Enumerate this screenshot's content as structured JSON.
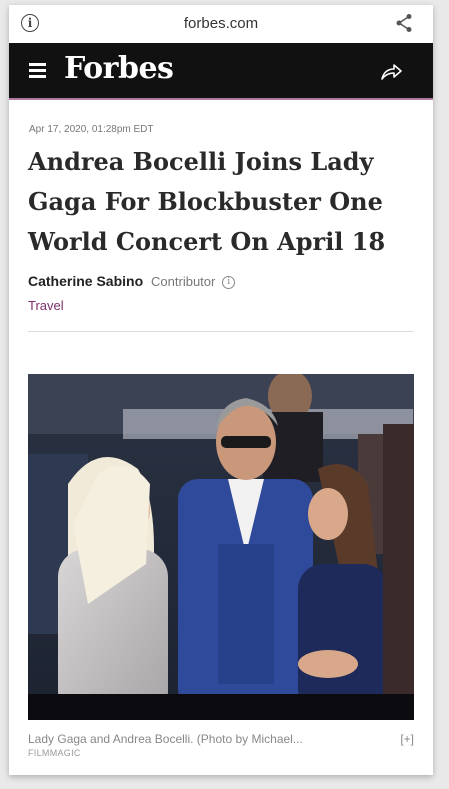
{
  "browser": {
    "url": "forbes.com",
    "info_icon": "info-icon",
    "share_icon": "share-icon"
  },
  "site_header": {
    "logo": "Forbes",
    "menu_icon": "hamburger-menu-icon",
    "share_icon": "share-arrow-icon",
    "accent_color": "#b07aa1"
  },
  "article": {
    "date": "Apr 17, 2020, 01:28pm EDT",
    "headline": "Andrea Bocelli Joins Lady Gaga For Blockbuster One World Concert On April 18",
    "author": "Catherine Sabino",
    "author_role": "Contributor",
    "section": "Travel",
    "image_caption": "Lady Gaga and Andrea Bocelli. (Photo by Michael...",
    "caption_expand": "[+]",
    "image_credit": "FILMMAGIC"
  },
  "colors": {
    "header_bg": "#111111",
    "section_link": "#7b2f6a",
    "headline": "#2a2a2a"
  }
}
